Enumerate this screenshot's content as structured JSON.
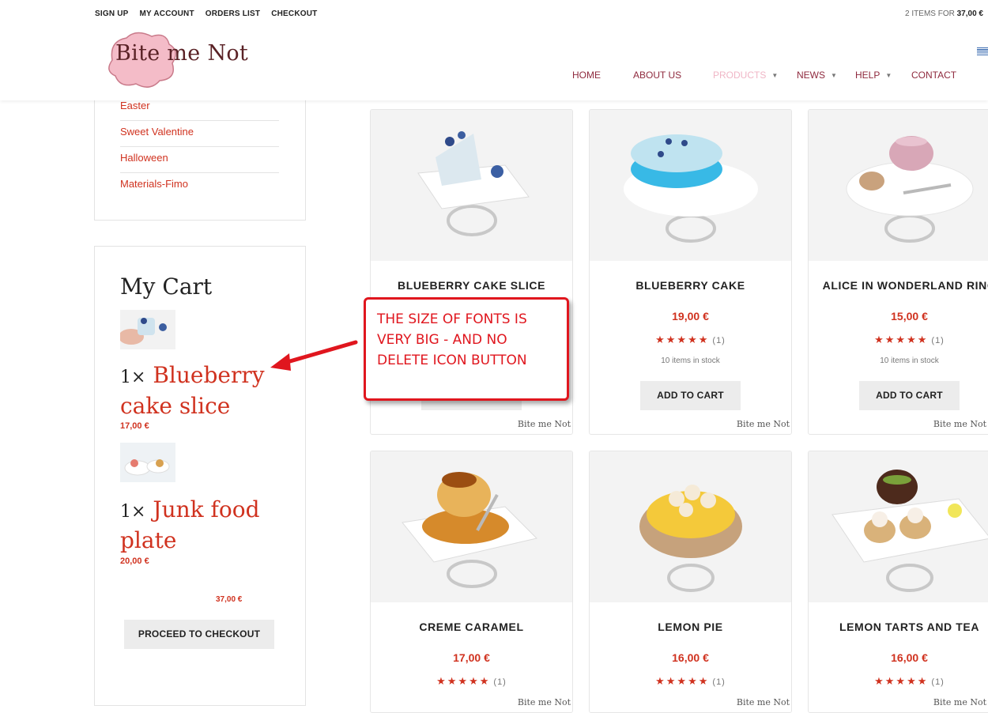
{
  "topbar": {
    "links": [
      "SIGN UP",
      "MY ACCOUNT",
      "ORDERS LIST",
      "CHECKOUT"
    ],
    "cart_summary_prefix": "2 ITEMS FOR",
    "cart_summary_total": "37,00 €"
  },
  "logo": {
    "text": "Bite me Not"
  },
  "nav": {
    "items": [
      {
        "label": "HOME"
      },
      {
        "label": "ABOUT US"
      },
      {
        "label": "PRODUCTS",
        "active": true
      },
      {
        "label": "NEWS"
      },
      {
        "label": "HELP"
      },
      {
        "label": "CONTACT"
      }
    ]
  },
  "categories": [
    "Easter",
    "Sweet Valentine",
    "Halloween",
    "Materials-Fimo"
  ],
  "cart": {
    "title": "My Cart",
    "items": [
      {
        "qty": "1×",
        "name": "Blueberry cake slice",
        "price": "17,00 €"
      },
      {
        "qty": "1×",
        "name": "Junk food plate",
        "price": "20,00 €"
      }
    ],
    "total": "37,00 €",
    "checkout_label": "PROCEED TO CHECKOUT"
  },
  "products": [
    {
      "title": "BLUEBERRY CAKE SLICE",
      "price": "",
      "rating": "",
      "stock": "",
      "button": ""
    },
    {
      "title": "BLUEBERRY CAKE",
      "price": "19,00 €",
      "rating": "(1)",
      "stock": "10 items in stock",
      "button": "ADD TO CART"
    },
    {
      "title": "ALICE IN WONDERLAND RING",
      "price": "15,00 €",
      "rating": "(1)",
      "stock": "10 items in stock",
      "button": "ADD TO CART"
    },
    {
      "title": "CREME CARAMEL",
      "price": "17,00 €",
      "rating": "(1)"
    },
    {
      "title": "LEMON PIE",
      "price": "16,00 €",
      "rating": "(1)"
    },
    {
      "title": "LEMON TARTS AND TEA",
      "price": "16,00 €",
      "rating": "(1)"
    }
  ],
  "product_stars": "★★★★★",
  "watermark": "Bite me Not",
  "annotation": {
    "text": "THE SIZE OF FONTS IS VERY BIG - AND NO DELETE ICON BUTTON"
  },
  "colors": {
    "accent": "#d0321f",
    "nav": "#8f2a3e",
    "nav_active": "#f0b6c6",
    "annotation": "#e0161e"
  }
}
